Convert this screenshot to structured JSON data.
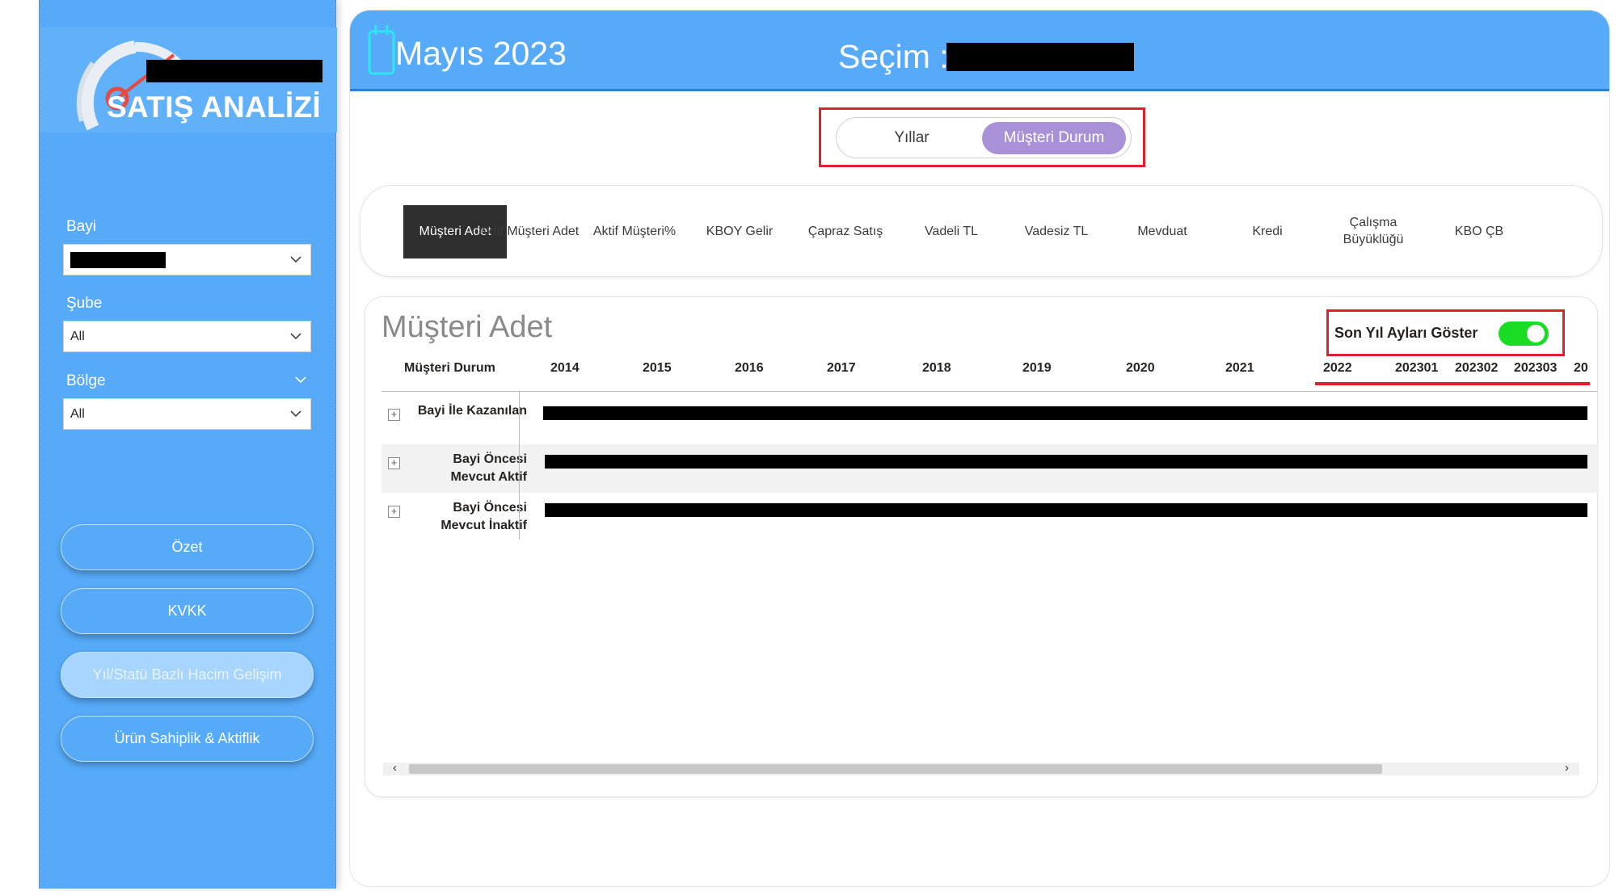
{
  "sidebar": {
    "app_title": "SATIŞ ANALİZİ",
    "filters": [
      {
        "label": "Bayi",
        "value": ""
      },
      {
        "label": "Şube",
        "value": "All"
      },
      {
        "label": "Bölge",
        "value": "All"
      }
    ],
    "nav": [
      {
        "label": "Özet",
        "active": false
      },
      {
        "label": "KVKK",
        "active": false
      },
      {
        "label": "Yıl/Statü Bazlı Hacim Gelişim",
        "active": true
      },
      {
        "label": "Ürün Sahiplik & Aktiflik",
        "active": false
      }
    ]
  },
  "header": {
    "date": "Mayıs 2023",
    "selection_label": "Seçim :"
  },
  "view_toggle": {
    "options": [
      "Yıllar",
      "Müşteri Durum"
    ],
    "selected": "Müşteri Durum"
  },
  "metric_tabs": [
    "Müşteri Adet",
    "Aktif Müşteri Adet",
    "Aktif Müşteri%",
    "KBOY Gelir",
    "Çapraz Satış",
    "Vadeli TL",
    "Vadesiz TL",
    "Mevduat",
    "Kredi",
    "Çalışma Büyüklüğü",
    "KBO ÇB"
  ],
  "selected_metric": "Müşteri Adet",
  "matrix": {
    "title": "Müşteri Adet",
    "switch_label": "Son Yıl Ayları Göster",
    "switch_on": true,
    "row_header": "Müşteri Durum",
    "columns": [
      "2014",
      "2015",
      "2016",
      "2017",
      "2018",
      "2019",
      "2020",
      "2021",
      "2022",
      "202301",
      "202302",
      "202303"
    ],
    "clipped_column": "20",
    "rows": [
      "Bayi İle Kazanılan",
      "Bayi Öncesi Mevcut Aktif",
      "Bayi Öncesi Mevcut İnaktif"
    ]
  },
  "colors": {
    "sidebar_bg": "#56aaf8",
    "header_bg": "#56aaf8",
    "toggle_selected": "#a991d8",
    "highlight_red": "#e0202b",
    "switch_on": "#19dd25",
    "active_tab": "#2f2f2f"
  }
}
